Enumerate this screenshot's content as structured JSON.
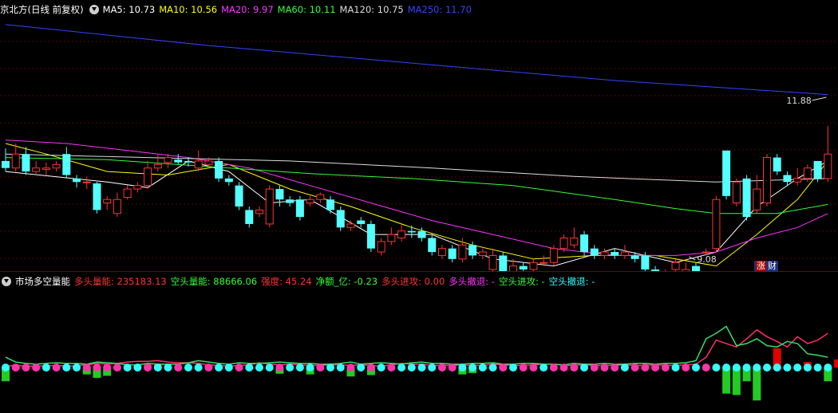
{
  "main_header": {
    "title": "京北方(日线 前复权)",
    "ma_labels": [
      {
        "text": "MA5: 10.73",
        "color": "#ffffff"
      },
      {
        "text": "MA10: 10.56",
        "color": "#ffff00"
      },
      {
        "text": "MA20: 9.97",
        "color": "#ff33ff"
      },
      {
        "text": "MA60: 10.11",
        "color": "#33ff33"
      },
      {
        "text": "MA120: 10.75",
        "color": "#dddddd"
      },
      {
        "text": "MA250: 11.70",
        "color": "#3344ff"
      }
    ]
  },
  "sub_header": {
    "title": "市场多空量能",
    "fields": [
      {
        "text": "多头量能: 235183.13",
        "color": "#ff3333"
      },
      {
        "text": "空头量能: 88666.06",
        "color": "#33ff33"
      },
      {
        "text": "强度: 45.24",
        "color": "#ff3333"
      },
      {
        "text": "净额_亿: -0.23",
        "color": "#33ff33"
      },
      {
        "text": "多头进攻: 0.00",
        "color": "#ff3333"
      },
      {
        "text": "多头撤退: -",
        "color": "#ff33ff"
      },
      {
        "text": "空头进攻: -",
        "color": "#33ff33"
      },
      {
        "text": "空头撤退: -",
        "color": "#33ffff"
      }
    ]
  },
  "annotations": {
    "high_label": "11.88",
    "low_label": "9.08"
  },
  "badge": {
    "zhang": "涨",
    "cai": "财"
  },
  "colors": {
    "up": "#ff3232",
    "down": "#54ffff",
    "ma5": "#ffffff",
    "ma10": "#ffff00",
    "ma20": "#ff33ff",
    "ma60": "#33ff33",
    "ma120": "#dddddd",
    "ma250": "#3344ff"
  },
  "chart_data": {
    "type": "candlestick",
    "price_range": [
      8.75,
      12.35
    ],
    "candles": [
      [
        10.3,
        10.2,
        10.48,
        10.15
      ],
      [
        10.2,
        10.4,
        10.55,
        10.15
      ],
      [
        10.4,
        10.15,
        10.5,
        10.1
      ],
      [
        10.15,
        10.2,
        10.3,
        10.12
      ],
      [
        10.18,
        10.2,
        10.28,
        10.1
      ],
      [
        10.2,
        10.25,
        10.3,
        10.15
      ],
      [
        10.4,
        10.1,
        10.5,
        10.05
      ],
      [
        10.05,
        10.0,
        10.1,
        9.92
      ],
      [
        10.0,
        10.0,
        10.08,
        9.9
      ],
      [
        9.98,
        9.6,
        10.0,
        9.55
      ],
      [
        9.7,
        9.75,
        9.8,
        9.6
      ],
      [
        9.55,
        9.75,
        9.85,
        9.5
      ],
      [
        9.78,
        9.9,
        9.95,
        9.75
      ],
      [
        9.9,
        9.95,
        10.0,
        9.85
      ],
      [
        9.95,
        10.2,
        10.3,
        9.9
      ],
      [
        10.2,
        10.25,
        10.4,
        10.15
      ],
      [
        10.28,
        10.35,
        10.4,
        10.2
      ],
      [
        10.32,
        10.28,
        10.4,
        10.25
      ],
      [
        10.3,
        10.28,
        10.35,
        10.22
      ],
      [
        10.2,
        10.3,
        10.45,
        10.15
      ],
      [
        10.25,
        10.3,
        10.35,
        10.2
      ],
      [
        10.3,
        10.05,
        10.35,
        10.0
      ],
      [
        10.05,
        10.0,
        10.1,
        9.95
      ],
      [
        9.95,
        9.65,
        10.0,
        9.6
      ],
      [
        9.6,
        9.4,
        9.65,
        9.35
      ],
      [
        9.55,
        9.6,
        9.65,
        9.5
      ],
      [
        9.4,
        9.9,
        9.95,
        9.35
      ],
      [
        9.9,
        9.75,
        9.95,
        9.65
      ],
      [
        9.75,
        9.7,
        9.8,
        9.65
      ],
      [
        9.75,
        9.5,
        9.8,
        9.45
      ],
      [
        9.7,
        9.75,
        9.8,
        9.65
      ],
      [
        9.75,
        9.82,
        9.85,
        9.7
      ],
      [
        9.75,
        9.6,
        9.8,
        9.55
      ],
      [
        9.6,
        9.35,
        9.65,
        9.3
      ],
      [
        9.35,
        9.4,
        9.45,
        9.3
      ],
      [
        9.45,
        9.4,
        9.5,
        9.35
      ],
      [
        9.4,
        9.05,
        9.45,
        9.0
      ],
      [
        9.0,
        9.15,
        9.2,
        8.95
      ],
      [
        9.15,
        9.25,
        9.35,
        9.1
      ],
      [
        9.2,
        9.3,
        9.4,
        9.15
      ],
      [
        9.3,
        9.28,
        9.38,
        9.2
      ],
      [
        9.3,
        9.2,
        9.35,
        9.15
      ],
      [
        9.2,
        9.0,
        9.25,
        8.95
      ],
      [
        8.95,
        9.05,
        9.1,
        8.9
      ],
      [
        9.05,
        8.9,
        9.1,
        8.85
      ],
      [
        8.9,
        9.1,
        9.2,
        8.85
      ],
      [
        9.1,
        8.95,
        9.15,
        8.9
      ],
      [
        8.95,
        9.0,
        9.05,
        8.9
      ],
      [
        8.75,
        8.95,
        9.05,
        8.7
      ],
      [
        8.95,
        8.7,
        9.0,
        8.6
      ],
      [
        8.7,
        8.8,
        8.9,
        8.55
      ],
      [
        8.8,
        8.75,
        8.85,
        8.7
      ],
      [
        8.75,
        8.85,
        8.9,
        8.7
      ],
      [
        8.85,
        8.85,
        8.95,
        8.8
      ],
      [
        8.85,
        9.05,
        9.1,
        8.8
      ],
      [
        9.05,
        9.2,
        9.25,
        9.0
      ],
      [
        9.1,
        9.2,
        9.35,
        9.05
      ],
      [
        9.25,
        9.0,
        9.3,
        8.95
      ],
      [
        9.05,
        8.95,
        9.1,
        8.9
      ],
      [
        8.95,
        9.0,
        9.05,
        8.9
      ],
      [
        9.0,
        8.95,
        9.05,
        8.9
      ],
      [
        8.95,
        9.0,
        9.1,
        8.9
      ],
      [
        8.95,
        8.9,
        9.0,
        8.85
      ],
      [
        8.95,
        8.75,
        9.0,
        8.7
      ],
      [
        8.75,
        8.7,
        8.8,
        8.65
      ],
      [
        8.7,
        8.72,
        8.75,
        8.65
      ],
      [
        8.75,
        8.85,
        8.9,
        8.7
      ],
      [
        8.55,
        8.75,
        8.85,
        8.5
      ],
      [
        8.8,
        8.7,
        8.85,
        8.65
      ],
      [
        9.0,
        9.0,
        9.05,
        8.95
      ],
      [
        9.05,
        9.75,
        9.8,
        9.0
      ],
      [
        10.45,
        9.8,
        10.45,
        9.75
      ],
      [
        9.7,
        10.0,
        10.05,
        9.65
      ],
      [
        10.05,
        9.5,
        10.1,
        9.45
      ],
      [
        9.6,
        9.9,
        10.1,
        9.55
      ],
      [
        9.7,
        10.35,
        10.4,
        9.65
      ],
      [
        10.35,
        10.15,
        10.4,
        10.1
      ],
      [
        10.1,
        10.0,
        10.15,
        9.95
      ],
      [
        10.0,
        10.05,
        10.2,
        9.95
      ],
      [
        10.05,
        10.2,
        10.25,
        10.0
      ],
      [
        10.3,
        10.05,
        10.3,
        10.0
      ],
      [
        10.05,
        10.4,
        10.8,
        10.0
      ]
    ],
    "ma_series": [
      {
        "name": "MA5",
        "color": "#ffffff",
        "points": [
          [
            0,
            10.15
          ],
          [
            10,
            10.0
          ],
          [
            14,
            9.92
          ],
          [
            18,
            10.3
          ],
          [
            22,
            10.15
          ],
          [
            26,
            9.7
          ],
          [
            30,
            9.75
          ],
          [
            36,
            9.25
          ],
          [
            42,
            9.25
          ],
          [
            48,
            8.9
          ],
          [
            54,
            8.8
          ],
          [
            60,
            9.05
          ],
          [
            66,
            8.85
          ],
          [
            70,
            9.0
          ],
          [
            74,
            9.65
          ],
          [
            78,
            10.05
          ],
          [
            81,
            10.3
          ]
        ]
      },
      {
        "name": "MA10",
        "color": "#ffff00",
        "points": [
          [
            0,
            10.55
          ],
          [
            4,
            10.4
          ],
          [
            10,
            10.15
          ],
          [
            16,
            10.1
          ],
          [
            22,
            10.25
          ],
          [
            28,
            9.9
          ],
          [
            34,
            9.65
          ],
          [
            40,
            9.35
          ],
          [
            46,
            9.1
          ],
          [
            52,
            8.9
          ],
          [
            58,
            8.95
          ],
          [
            64,
            8.95
          ],
          [
            70,
            8.8
          ],
          [
            74,
            9.25
          ],
          [
            78,
            9.75
          ],
          [
            81,
            10.3
          ]
        ]
      },
      {
        "name": "MA20",
        "color": "#ff33ff",
        "points": [
          [
            0,
            10.6
          ],
          [
            6,
            10.55
          ],
          [
            12,
            10.45
          ],
          [
            18,
            10.35
          ],
          [
            24,
            10.2
          ],
          [
            30,
            9.95
          ],
          [
            36,
            9.7
          ],
          [
            42,
            9.45
          ],
          [
            48,
            9.25
          ],
          [
            54,
            9.05
          ],
          [
            60,
            8.95
          ],
          [
            66,
            8.95
          ],
          [
            70,
            9.0
          ],
          [
            74,
            9.2
          ],
          [
            78,
            9.35
          ],
          [
            81,
            9.55
          ]
        ]
      },
      {
        "name": "MA60",
        "color": "#33ff33",
        "points": [
          [
            0,
            10.35
          ],
          [
            10,
            10.32
          ],
          [
            20,
            10.22
          ],
          [
            30,
            10.12
          ],
          [
            40,
            10.05
          ],
          [
            50,
            9.95
          ],
          [
            60,
            9.75
          ],
          [
            66,
            9.62
          ],
          [
            70,
            9.55
          ],
          [
            76,
            9.55
          ],
          [
            81,
            9.68
          ]
        ]
      },
      {
        "name": "MA120",
        "color": "#dddddd",
        "points": [
          [
            0,
            10.4
          ],
          [
            14,
            10.35
          ],
          [
            28,
            10.3
          ],
          [
            42,
            10.2
          ],
          [
            56,
            10.08
          ],
          [
            70,
            10.0
          ],
          [
            81,
            10.05
          ]
        ]
      },
      {
        "name": "MA250",
        "color": "#3344ff",
        "points": [
          [
            0,
            12.25
          ],
          [
            20,
            11.95
          ],
          [
            40,
            11.7
          ],
          [
            60,
            11.45
          ],
          [
            81,
            11.25
          ]
        ]
      }
    ],
    "sub_series": {
      "red_line": [
        0.2,
        0.3,
        0.2,
        0.2,
        0.25,
        0.3,
        0.2,
        0.25,
        0.4,
        0.6,
        0.5,
        0.6,
        0.8,
        0.9,
        0.9,
        1.0,
        0.8,
        0.7,
        0.7,
        0.6,
        0.4,
        0.3,
        0.2,
        0.3,
        0.4,
        0.7,
        0.5,
        0.4,
        0.5,
        0.4,
        0.3,
        0.3,
        0.4,
        0.4,
        0.3,
        0.4,
        0.3,
        0.2,
        0.4,
        0.6,
        0.5,
        0.5,
        0.3,
        0.3,
        0.3,
        0.4,
        0.3,
        0.3,
        0.5,
        0.4,
        0.3,
        0.3,
        0.4,
        0.5,
        0.5,
        0.3,
        0.3,
        0.4,
        0.3,
        0.3,
        0.3,
        0.4,
        0.3,
        0.3,
        0.4,
        0.3,
        0.3,
        0.4,
        0.5,
        1.5,
        4.0,
        3.5,
        3.0,
        4.2,
        5.5,
        4.5,
        3.8,
        3.0,
        4.5,
        3.5,
        4.0,
        5.0
      ],
      "green_line": [
        1.5,
        0.8,
        0.6,
        0.5,
        0.6,
        0.7,
        0.6,
        0.6,
        0.5,
        0.8,
        0.7,
        0.6,
        0.4,
        0.4,
        0.6,
        0.5,
        0.5,
        0.5,
        0.7,
        1.0,
        0.8,
        0.6,
        0.5,
        0.7,
        0.6,
        0.6,
        0.7,
        0.8,
        0.7,
        0.6,
        0.6,
        0.5,
        0.5,
        0.6,
        0.8,
        0.5,
        0.6,
        0.7,
        0.6,
        0.5,
        0.7,
        0.8,
        0.6,
        0.6,
        0.5,
        0.5,
        0.6,
        0.6,
        0.7,
        0.5,
        0.5,
        0.6,
        0.6,
        0.5,
        0.5,
        0.4,
        0.6,
        0.5,
        0.5,
        0.6,
        0.5,
        0.5,
        0.6,
        0.6,
        0.5,
        0.6,
        0.6,
        0.7,
        1.0,
        4.2,
        5.0,
        6.0,
        3.2,
        3.5,
        4.2,
        3.2,
        3.0,
        3.8,
        3.5,
        2.0,
        1.8,
        1.5
      ],
      "bars": [
        -2.0,
        0,
        0,
        0,
        0,
        0,
        0,
        0,
        -1.0,
        -1.5,
        -1.2,
        0,
        0,
        0.4,
        0.5,
        0.5,
        0,
        0,
        0,
        0,
        0.3,
        0,
        0,
        0,
        0,
        0,
        0,
        -0.9,
        0,
        0,
        -1.0,
        0,
        0,
        0,
        -1.3,
        0,
        -1.1,
        0,
        0,
        0,
        0,
        0,
        0,
        0,
        0,
        -1.0,
        -0.8,
        0,
        0,
        0.3,
        0,
        0,
        0,
        0,
        0,
        0,
        0,
        0,
        0,
        0,
        0,
        0,
        0,
        0,
        0,
        0,
        0,
        0,
        0,
        0,
        0,
        -3.8,
        -4.0,
        -2.0,
        -4.8,
        0,
        2.8,
        0,
        0,
        0.8,
        0,
        -2.0,
        1.2,
        3.0
      ],
      "dots": [
        0,
        1,
        1,
        1,
        0,
        1,
        0,
        0,
        1,
        1,
        1,
        1,
        0,
        0,
        1,
        0,
        0,
        1,
        0,
        0,
        1,
        0,
        0,
        1,
        0,
        0,
        0,
        1,
        0,
        0,
        0,
        1,
        0,
        0,
        1,
        0,
        1,
        0,
        1,
        0,
        0,
        0,
        0,
        1,
        1,
        0,
        0,
        0,
        0,
        1,
        0,
        1,
        1,
        0,
        1,
        1,
        1,
        0,
        1,
        1,
        1,
        0,
        1,
        1,
        1,
        1,
        0,
        1,
        0,
        1,
        0,
        0,
        0,
        0,
        0,
        0,
        0,
        0,
        0,
        0,
        0,
        0
      ],
      "range": [
        -6,
        8
      ]
    }
  }
}
